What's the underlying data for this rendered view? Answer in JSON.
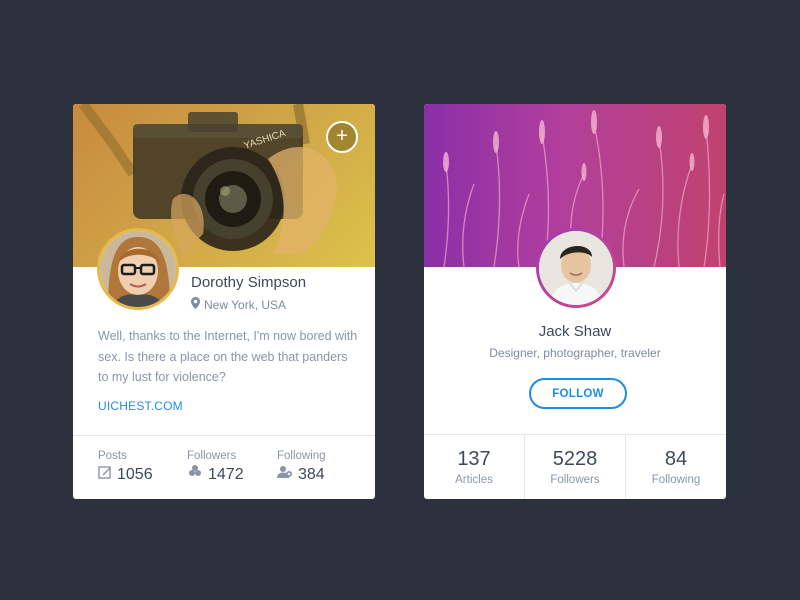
{
  "profile_card_1": {
    "name": "Dorothy Simpson",
    "location": "New York, USA",
    "bio": "Well, thanks to the Internet, I'm now bored with sex. Is there a place on the web that panders to my lust for violence?",
    "link": "UICHEST.COM",
    "add_label": "+",
    "camera_brand": "YASHICA",
    "stats": [
      {
        "label": "Posts",
        "value": "1056",
        "icon": "edit-icon"
      },
      {
        "label": "Followers",
        "value": "1472",
        "icon": "followers-icon"
      },
      {
        "label": "Following",
        "value": "384",
        "icon": "following-icon"
      }
    ]
  },
  "profile_card_2": {
    "name": "Jack Shaw",
    "role": "Designer, photographer, traveler",
    "follow_label": "FOLLOW",
    "stats": [
      {
        "value": "137",
        "label": "Articles"
      },
      {
        "value": "5228",
        "label": "Followers"
      },
      {
        "value": "84",
        "label": "Following"
      }
    ]
  },
  "colors": {
    "background": "#2c323d",
    "accent": "#1f8ce6",
    "card": "#ffffff",
    "text_primary": "#3d4a5c",
    "text_secondary": "#8a95a8"
  }
}
